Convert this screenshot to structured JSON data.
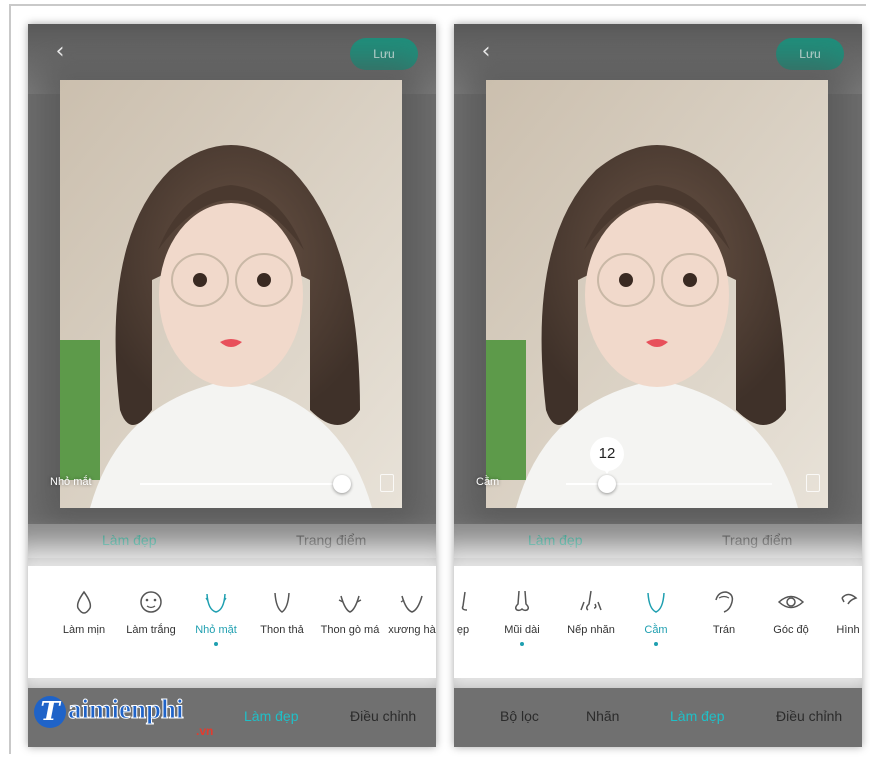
{
  "colors": {
    "accent": "#1f8f7c",
    "active_tool": "#1f9fb0",
    "active_nav": "#1fc0c8"
  },
  "left": {
    "save_label": "Lưu",
    "slider": {
      "label": "Nhỏ mắt",
      "value_fraction": 0.98
    },
    "mode_tabs": [
      "Làm đẹp",
      "Trang điểm"
    ],
    "tools": [
      {
        "label": "Làm mịn",
        "icon": "drop-icon"
      },
      {
        "label": "Làm trắng",
        "icon": "face-mask-icon"
      },
      {
        "label": "Nhỏ mặt",
        "icon": "face-chin-icon",
        "active": true
      },
      {
        "label": "Thon thả",
        "icon": "face-slim-icon"
      },
      {
        "label": "Thon gò má",
        "icon": "cheekbone-icon"
      },
      {
        "label": "xương hà",
        "icon": "jaw-icon"
      }
    ],
    "nav": [
      "Làm đẹp",
      "Điều chỉnh"
    ]
  },
  "right": {
    "save_label": "Lưu",
    "slider": {
      "label": "Cằm",
      "value": "12",
      "value_fraction": 0.2
    },
    "mode_tabs": [
      "Làm đẹp",
      "Trang điểm"
    ],
    "tools": [
      {
        "label": "ẹp",
        "icon": "nose-partial-icon"
      },
      {
        "label": "Mũi dài",
        "icon": "nose-long-icon",
        "marked": true
      },
      {
        "label": "Nếp nhăn",
        "icon": "wrinkle-icon"
      },
      {
        "label": "Cằm",
        "icon": "chin-icon",
        "active": true
      },
      {
        "label": "Trán",
        "icon": "forehead-icon"
      },
      {
        "label": "Góc độ",
        "icon": "eye-icon"
      },
      {
        "label": "Hình",
        "icon": "shape-icon"
      }
    ],
    "nav": [
      "Bộ lọc",
      "Nhãn",
      "Làm đẹp",
      "Điều chỉnh"
    ]
  },
  "watermark": {
    "letter": "T",
    "text": "aimienphi",
    "suffix": ".vn"
  }
}
